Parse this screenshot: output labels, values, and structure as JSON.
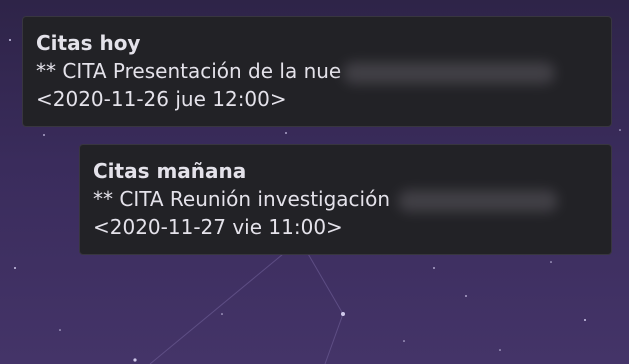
{
  "notifications": [
    {
      "title": "Citas hoy",
      "event": "** CITA Presentación de la nue",
      "timestamp": "<2020-11-26 jue 12:00>"
    },
    {
      "title": "Citas mañana",
      "event": "** CITA Reunión investigación",
      "timestamp": "<2020-11-27 vie 11:00>"
    }
  ],
  "colors": {
    "notification_bg": "#222226",
    "notification_text": "#e4e2ea",
    "wallpaper": "#3a2c5c"
  }
}
